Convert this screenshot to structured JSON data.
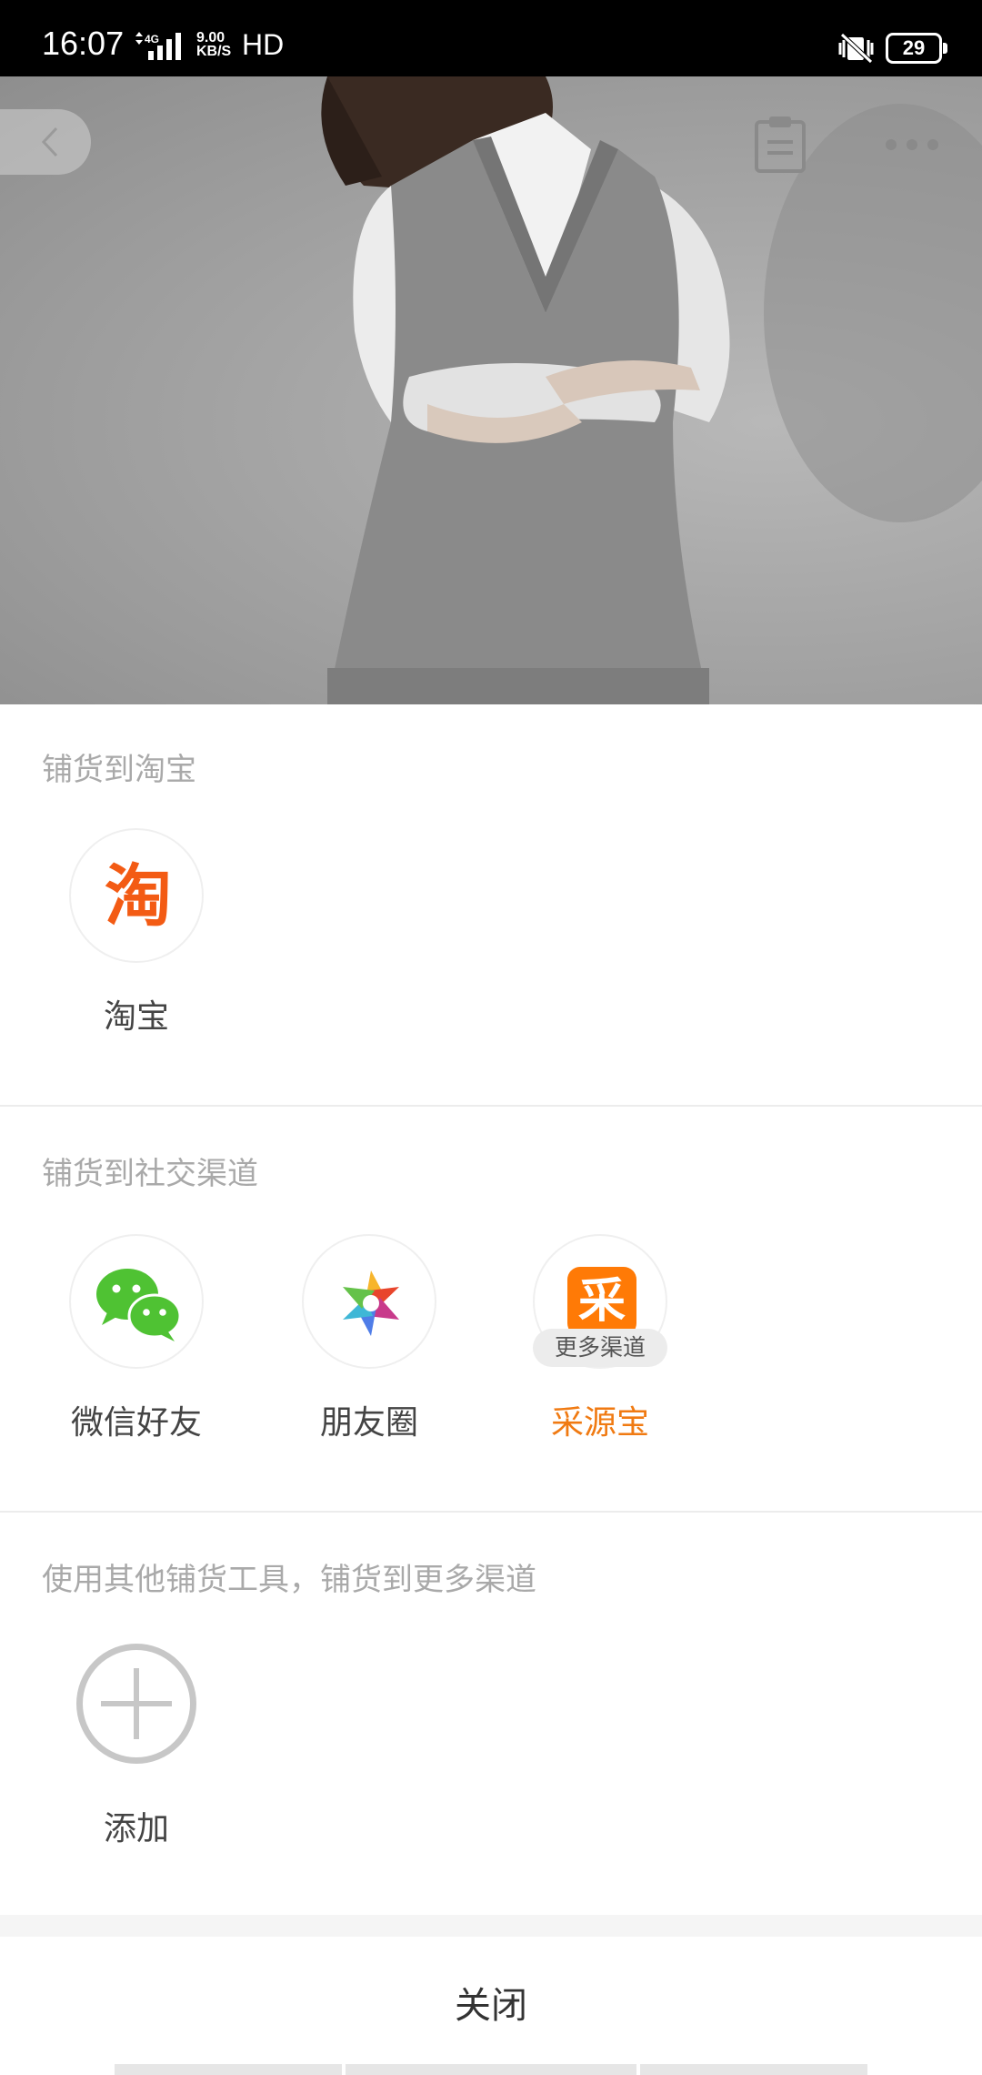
{
  "status_bar": {
    "time": "16:07",
    "network": "4G",
    "speed_value": "9.00",
    "speed_unit": "KB/S",
    "hd": "HD",
    "battery": "29"
  },
  "hero": {
    "back_icon": "chevron-left-icon",
    "clipboard_icon": "clipboard-icon",
    "more_icon": "more-dots-icon"
  },
  "sections": {
    "taobao": {
      "title": "铺货到淘宝",
      "items": [
        {
          "label": "淘宝",
          "glyph": "淘",
          "icon": "taobao-icon",
          "color": "#f35b14"
        }
      ]
    },
    "social": {
      "title": "铺货到社交渠道",
      "items": [
        {
          "label": "微信好友",
          "icon": "wechat-icon",
          "color": "#4fc233"
        },
        {
          "label": "朋友圈",
          "icon": "moments-icon"
        },
        {
          "label": "采源宝",
          "glyph": "采",
          "icon": "caiyuanbao-icon",
          "color": "#f07a12",
          "badge": "更多渠道"
        }
      ]
    },
    "other": {
      "title": "使用其他铺货工具，铺货到更多渠道",
      "items": [
        {
          "label": "添加",
          "icon": "add-circle-icon"
        }
      ]
    }
  },
  "close_label": "关闭"
}
